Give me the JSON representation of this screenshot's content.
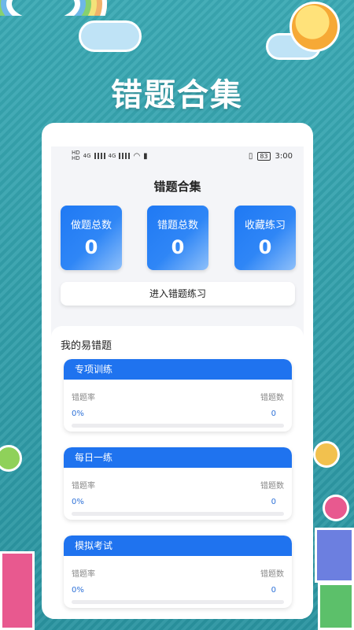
{
  "banner_title": "错题合集",
  "status_bar": {
    "left_icons": [
      "hd-icon",
      "signal-icon",
      "signal-icon",
      "wifi-icon",
      "battery-small-icon"
    ],
    "signal_1": "4G",
    "signal_2": "4G",
    "battery": "83",
    "time": "3:00"
  },
  "app": {
    "title": "错题合集",
    "stats": [
      {
        "label": "做题总数",
        "value": "0"
      },
      {
        "label": "错题总数",
        "value": "0"
      },
      {
        "label": "收藏练习",
        "value": "0"
      }
    ],
    "enter_button": "进入错题练习",
    "section_title": "我的易错题",
    "cards": [
      {
        "title": "专项训练",
        "rate_label": "错题率",
        "count_label": "错题数",
        "rate": "0%",
        "count": "0",
        "progress": 0
      },
      {
        "title": "每日一练",
        "rate_label": "错题率",
        "count_label": "错题数",
        "rate": "0%",
        "count": "0",
        "progress": 0
      },
      {
        "title": "模拟考试",
        "rate_label": "错题率",
        "count_label": "错题数",
        "rate": "0%",
        "count": "0",
        "progress": 0
      }
    ]
  },
  "colors": {
    "background": "#2e9aa4",
    "accent_blue": "#1f73ef",
    "rate_text": "#2f72d8"
  }
}
